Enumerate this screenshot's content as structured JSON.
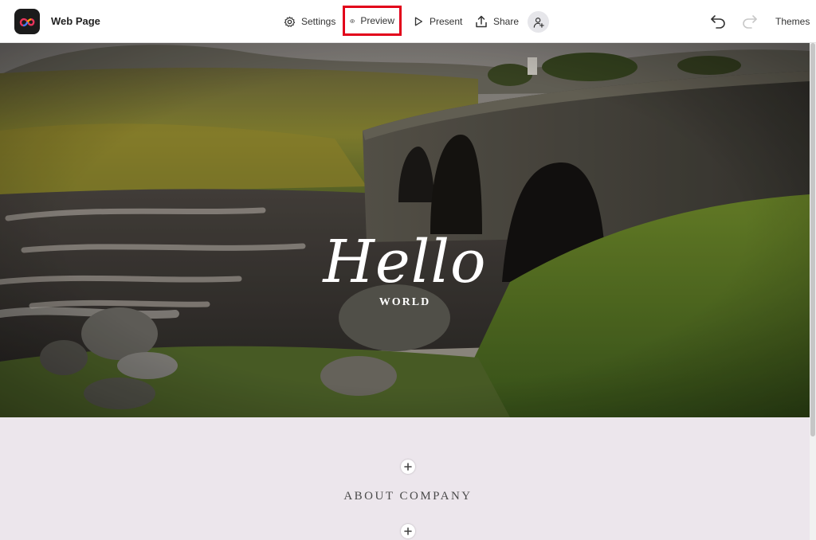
{
  "app": {
    "logo_icon": "creative-cloud-logo-icon",
    "doc_title": "Web Page"
  },
  "toolbar": {
    "settings_label": "Settings",
    "preview_label": "Preview",
    "present_label": "Present",
    "share_label": "Share",
    "invite_icon": "add-person-icon",
    "undo_icon": "undo-icon",
    "redo_icon": "redo-icon",
    "themes_label": "Themes",
    "highlight_color": "#e2001a"
  },
  "hero": {
    "title": "Hello",
    "subtitle": "WORLD"
  },
  "section": {
    "title": "ABOUT COMPANY"
  }
}
